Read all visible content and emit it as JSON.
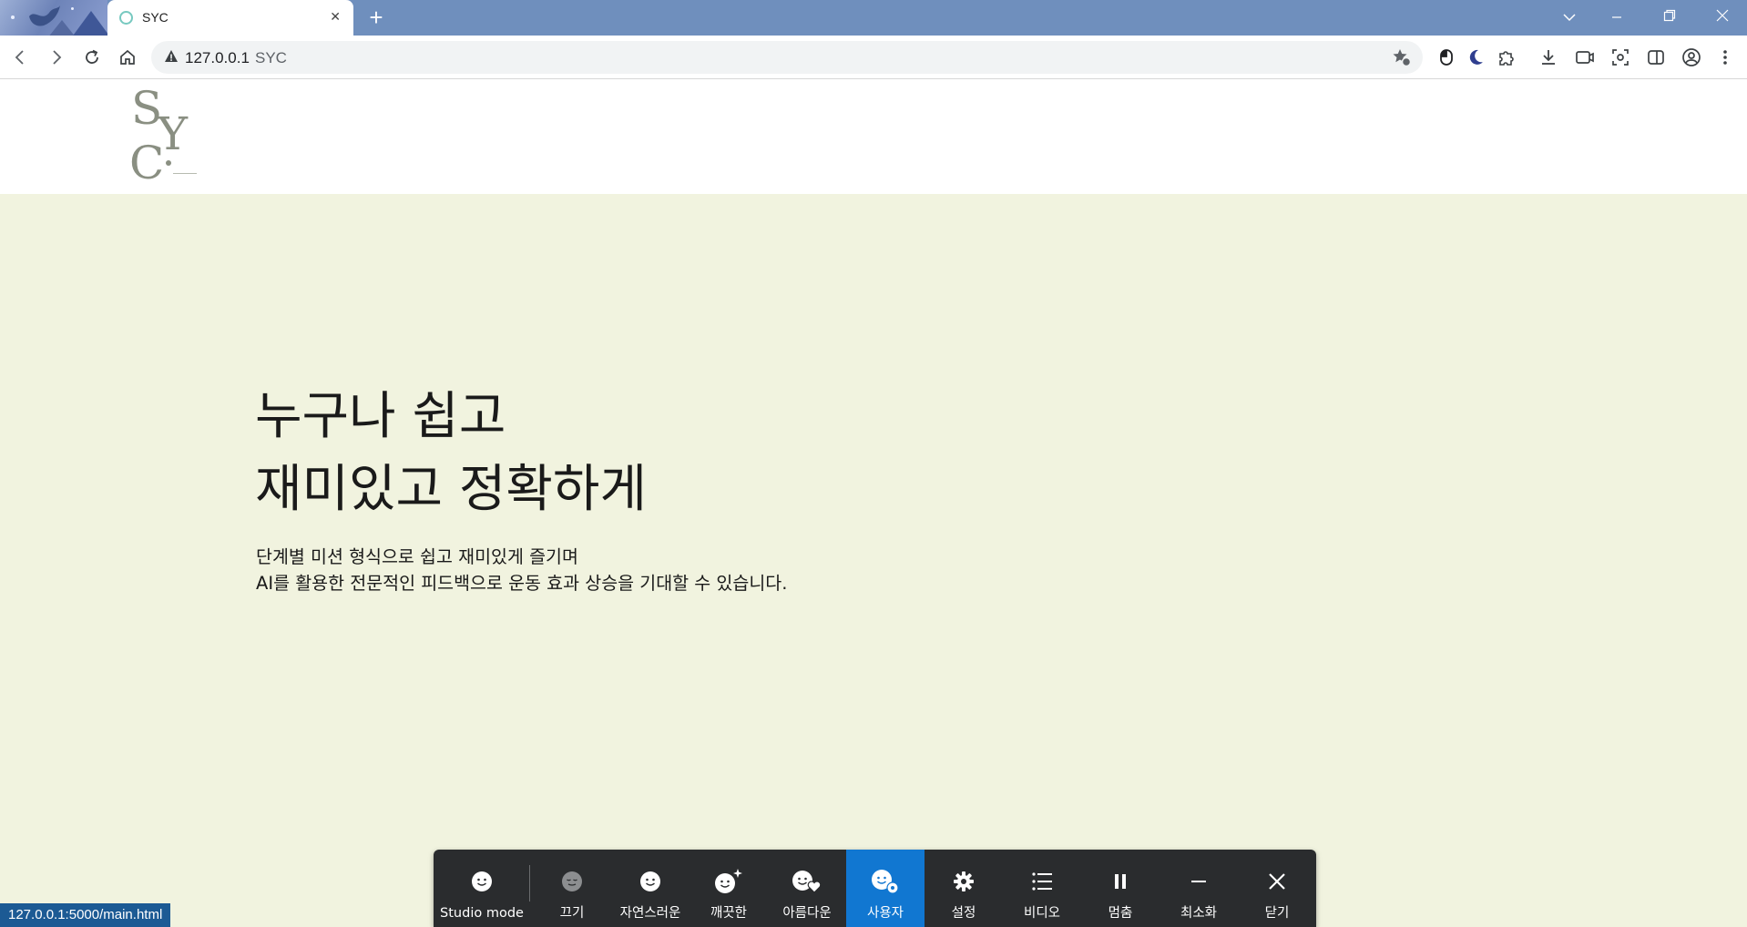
{
  "browser": {
    "tab": {
      "title": "SYC"
    },
    "url": {
      "host": "127.0.0.1",
      "title": "SYC"
    }
  },
  "page": {
    "hero": {
      "title_line1": "누구나 쉽고",
      "title_line2": "재미있고 정확하게",
      "desc_line1": "단계별 미션 형식으로 쉽고 재미있게 즐기며",
      "desc_line2": "AI를 활용한 전문적인 피드백으로 운동 효과 상승을 기대할 수 있습니다."
    },
    "colors": {
      "hero_bg": "#f1f3df",
      "accent": "#1177d1",
      "overlay_bg": "#2a2c2e"
    }
  },
  "status_bubble": "127.0.0.1:5000/main.html",
  "overlay": {
    "items": [
      {
        "label": "Studio mode",
        "icon": "face-smile-icon"
      },
      {
        "label": "끄기",
        "icon": "face-sleep-icon"
      },
      {
        "label": "자연스러운",
        "icon": "face-smile-icon"
      },
      {
        "label": "깨끗한",
        "icon": "face-sparkle-icon"
      },
      {
        "label": "아름다운",
        "icon": "face-heart-icon"
      },
      {
        "label": "사용자",
        "icon": "face-gear-icon",
        "active": true
      },
      {
        "label": "설정",
        "icon": "gear-icon"
      },
      {
        "label": "비디오",
        "icon": "list-icon"
      },
      {
        "label": "멈춤",
        "icon": "pause-icon"
      },
      {
        "label": "최소화",
        "icon": "minimize-icon"
      },
      {
        "label": "닫기",
        "icon": "close-icon"
      }
    ]
  }
}
